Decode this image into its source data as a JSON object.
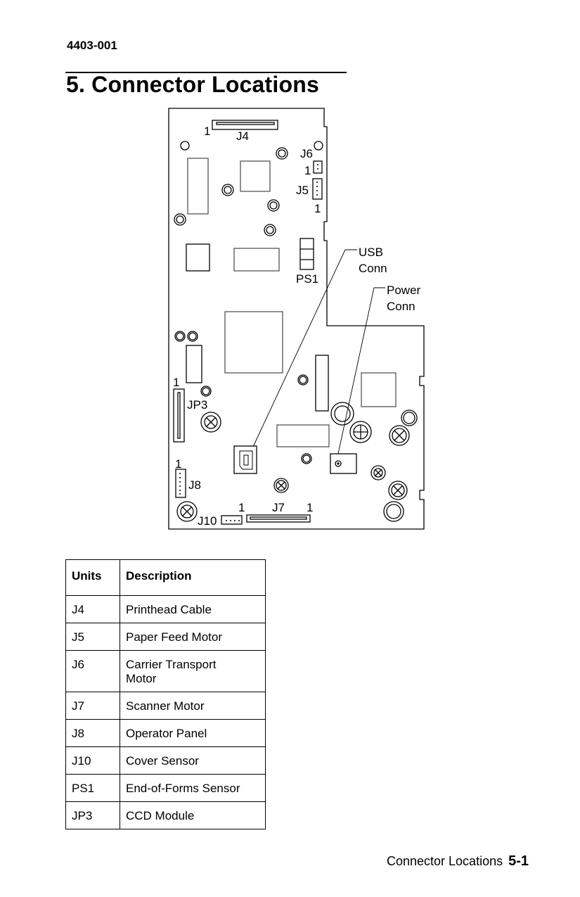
{
  "header": {
    "doc_id": "4403-001"
  },
  "page_title": "5.  Connector Locations",
  "diagram": {
    "labels": {
      "j4": "J4",
      "j4_pin": "1",
      "j6": "J6",
      "j6_pin": "1",
      "j5": "J5",
      "j5_pin": "1",
      "ps1": "PS1",
      "usb_1": "USB",
      "usb_2": "Conn",
      "power_1": "Power",
      "power_2": "Conn",
      "jp3": "JP3",
      "jp3_pin": "1",
      "j8": "J8",
      "j8_pin": "1",
      "j10": "J10",
      "j10_pin": "1",
      "j7": "J7",
      "j7_pin": "1"
    }
  },
  "table": {
    "headers": [
      "Units",
      "Description"
    ],
    "rows": [
      [
        "J4",
        "Printhead Cable"
      ],
      [
        "J5",
        "Paper Feed Motor"
      ],
      [
        "J6",
        "Carrier Transport Motor"
      ],
      [
        "J7",
        "Scanner Motor"
      ],
      [
        "J8",
        "Operator Panel"
      ],
      [
        "J10",
        "Cover Sensor"
      ],
      [
        "PS1",
        "End-of-Forms Sensor"
      ],
      [
        "JP3",
        "CCD Module"
      ]
    ]
  },
  "footer": {
    "section": "Connector Locations",
    "page": "5-1"
  }
}
